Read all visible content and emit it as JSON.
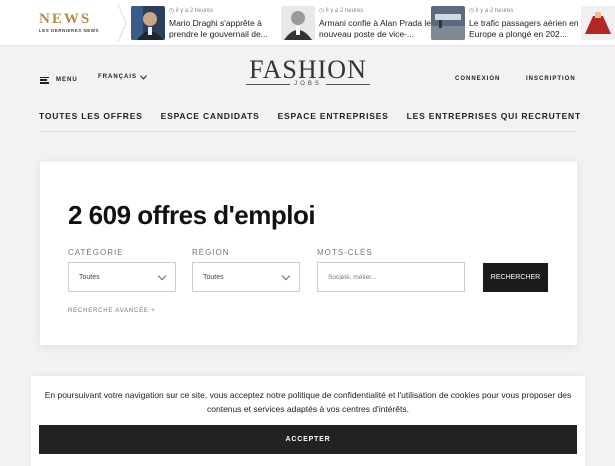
{
  "news": {
    "logo_big": "NEWS",
    "logo_small": "LES DERNIERES NEWS",
    "items": [
      {
        "meta": "il y a 2 heures",
        "title": "Mario Draghi s'apprête à prendre le gouvernail de..."
      },
      {
        "meta": "il y a 2 heures",
        "title": "Armani confie à Alan Prada le nouveau poste de vice-..."
      },
      {
        "meta": "il y a 2 heures",
        "title": "Le trafic passagers aérien en Europe a plongé en 202..."
      }
    ]
  },
  "header": {
    "menu_label": "MENU",
    "language": "FRANÇAIS",
    "logo_main": "FASHION",
    "logo_sub": "JOBS",
    "login": "CONNEXION",
    "register": "INSCRIPTION"
  },
  "nav": [
    "TOUTES LES OFFRES",
    "ESPACE CANDIDATS",
    "ESPACE ENTREPRISES",
    "LES ENTREPRISES QUI RECRUTENT"
  ],
  "search": {
    "title": "2 609 offres d'emploi",
    "category_label": "CATÉGORIE",
    "category_value": "Toutes",
    "region_label": "RÉGION",
    "region_value": "Toutes",
    "keywords_label": "MOTS-CLÉS",
    "keywords_placeholder": "Société, métier...",
    "button": "RECHERCHER",
    "advanced": "RECHERCHE AVANCÉE +"
  },
  "cookie": {
    "text": "En poursuivant votre navigation sur ce site, vous acceptez notre politique de confidentialité et l'utilisation de cookies pour vous proposer des contenus et services adaptés à vos centres d'intérêts.",
    "accept": "ACCEPTER"
  }
}
